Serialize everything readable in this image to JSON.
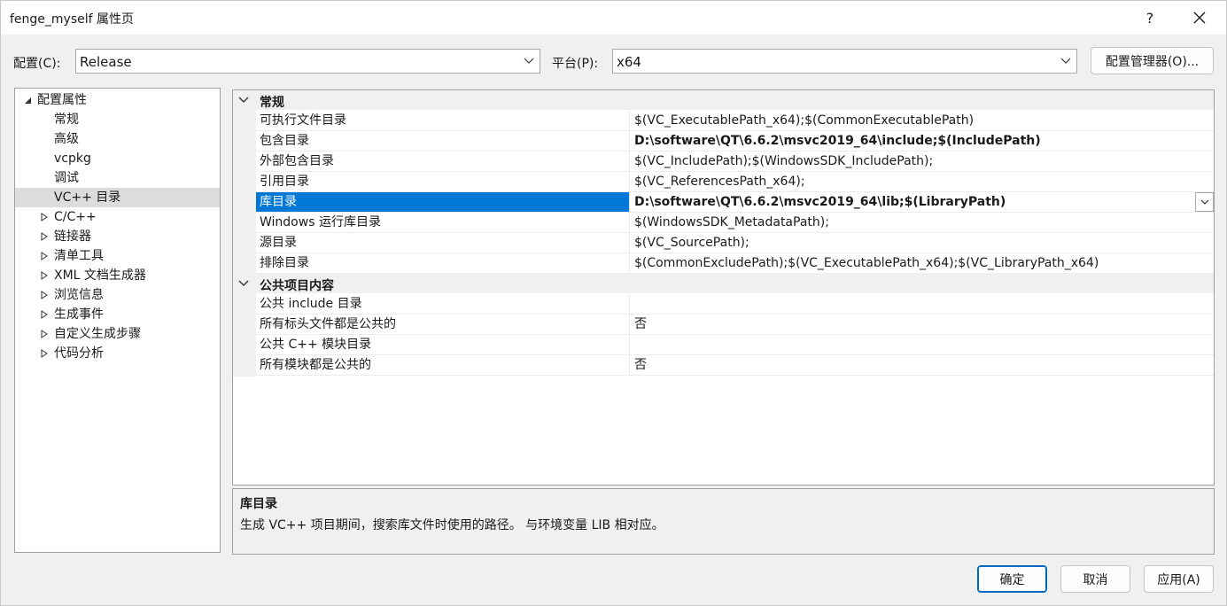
{
  "window": {
    "title": "fenge_myself 属性页",
    "help_label": "?",
    "close_icon": "close-icon"
  },
  "config": {
    "config_label": "配置(C):",
    "config_value": "Release",
    "platform_label": "平台(P):",
    "platform_value": "x64",
    "manager_button": "配置管理器(O)..."
  },
  "tree": {
    "root": "配置属性",
    "items": [
      {
        "label": "常规",
        "expandable": false
      },
      {
        "label": "高级",
        "expandable": false
      },
      {
        "label": "vcpkg",
        "expandable": false
      },
      {
        "label": "调试",
        "expandable": false
      },
      {
        "label": "VC++ 目录",
        "expandable": false,
        "selected": true
      },
      {
        "label": "C/C++",
        "expandable": true
      },
      {
        "label": "链接器",
        "expandable": true
      },
      {
        "label": "清单工具",
        "expandable": true
      },
      {
        "label": "XML 文档生成器",
        "expandable": true
      },
      {
        "label": "浏览信息",
        "expandable": true
      },
      {
        "label": "生成事件",
        "expandable": true
      },
      {
        "label": "自定义生成步骤",
        "expandable": true
      },
      {
        "label": "代码分析",
        "expandable": true
      }
    ]
  },
  "grid": {
    "categories": [
      {
        "name": "常规",
        "rows": [
          {
            "name": "可执行文件目录",
            "value": "$(VC_ExecutablePath_x64);$(CommonExecutablePath)",
            "bold": false
          },
          {
            "name": "包含目录",
            "value": "D:\\software\\QT\\6.6.2\\msvc2019_64\\include;$(IncludePath)",
            "bold": true
          },
          {
            "name": "外部包含目录",
            "value": "$(VC_IncludePath);$(WindowsSDK_IncludePath);",
            "bold": false
          },
          {
            "name": "引用目录",
            "value": "$(VC_ReferencesPath_x64);",
            "bold": false
          },
          {
            "name": "库目录",
            "value": "D:\\software\\QT\\6.6.2\\msvc2019_64\\lib;$(LibraryPath)",
            "bold": true,
            "selected": true
          },
          {
            "name": "Windows 运行库目录",
            "value": "$(WindowsSDK_MetadataPath);",
            "bold": false
          },
          {
            "name": "源目录",
            "value": "$(VC_SourcePath);",
            "bold": false
          },
          {
            "name": "排除目录",
            "value": "$(CommonExcludePath);$(VC_ExecutablePath_x64);$(VC_LibraryPath_x64)",
            "bold": false
          }
        ]
      },
      {
        "name": "公共项目内容",
        "rows": [
          {
            "name": "公共 include 目录",
            "value": "",
            "bold": false
          },
          {
            "name": "所有标头文件都是公共的",
            "value": "否",
            "bold": false
          },
          {
            "name": "公共 C++ 模块目录",
            "value": "",
            "bold": false
          },
          {
            "name": "所有模块都是公共的",
            "value": "否",
            "bold": false
          }
        ]
      }
    ]
  },
  "description": {
    "title": "库目录",
    "text": "生成 VC++ 项目期间，搜索库文件时使用的路径。 与环境变量 LIB 相对应。"
  },
  "buttons": {
    "ok": "确定",
    "cancel": "取消",
    "apply": "应用(A)"
  },
  "colors": {
    "selection": "#0078d7",
    "tree_selection": "#dcdcdc",
    "dialog_bg": "#f0f0f0"
  }
}
